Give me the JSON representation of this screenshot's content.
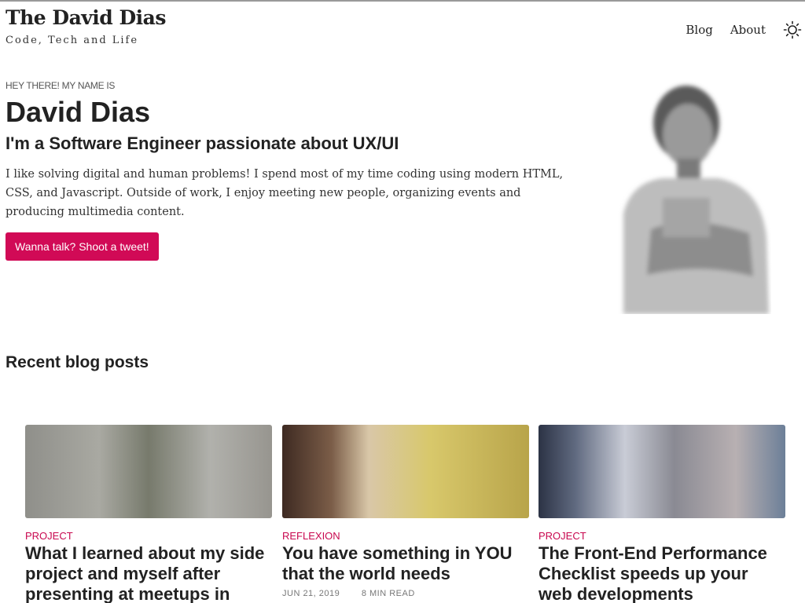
{
  "site": {
    "title": "The David Dias",
    "tagline": "Code, Tech and Life"
  },
  "nav": {
    "items": [
      "Blog",
      "About"
    ],
    "theme_icon": "sun-icon"
  },
  "hero": {
    "kicker": "HEY THERE! MY NAME IS",
    "name": "David Dias",
    "role": "I'm a Software Engineer passionate about UX/UI",
    "description": "I like solving digital and human problems! I spend most of my time coding using modern HTML, CSS, and Javascript. Outside of work, I enjoy meeting new people, organizing events and producing multimedia content.",
    "cta": "Wanna talk? Shoot a tweet!",
    "avatar": "profile-photo"
  },
  "blog": {
    "section_title": "Recent blog posts",
    "posts": [
      {
        "category": "PROJECT",
        "title": "What I learned about my side project and myself after presenting at meetups in",
        "date": "",
        "read_time": ""
      },
      {
        "category": "REFLEXION",
        "title": "You have something in YOU that the world needs",
        "date": "JUN 21, 2019",
        "read_time": "8 MIN READ"
      },
      {
        "category": "PROJECT",
        "title": "The Front-End Performance Checklist speeds up your web developments",
        "date": "",
        "read_time": ""
      }
    ]
  },
  "colors": {
    "accent": "#d10a56",
    "category": "#c8084f"
  }
}
